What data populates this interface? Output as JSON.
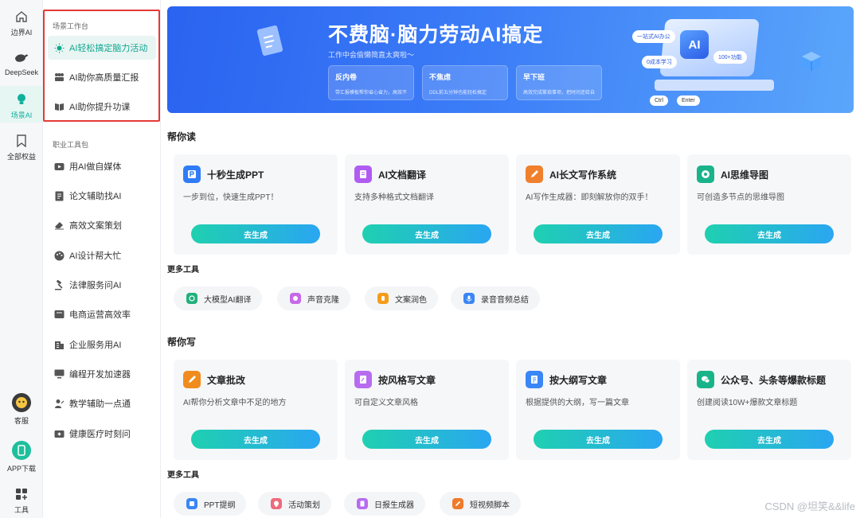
{
  "rail": {
    "items": [
      {
        "label": "边界AI",
        "icon": "home-icon"
      },
      {
        "label": "DeepSeek",
        "icon": "whale-icon"
      },
      {
        "label": "场景AI",
        "icon": "bulb-icon",
        "active": true
      },
      {
        "label": "全部权益",
        "icon": "bookmark-icon"
      },
      {
        "label": "客服",
        "icon": "service-avatar-icon"
      },
      {
        "label": "APP下载",
        "icon": "phone-icon"
      },
      {
        "label": "工具",
        "icon": "grid-icon"
      }
    ]
  },
  "panel": {
    "section1": "场景工作台",
    "workbench": [
      {
        "label": "AI轻松搞定脑力活动",
        "active": true
      },
      {
        "label": "AI助你高质量汇报"
      },
      {
        "label": "AI助你提升功课"
      }
    ],
    "section2": "职业工具包",
    "tools": [
      {
        "label": "用AI做自媒体"
      },
      {
        "label": "论文辅助找AI"
      },
      {
        "label": "高效文案策划"
      },
      {
        "label": "AI设计帮大忙"
      },
      {
        "label": "法律服务问AI"
      },
      {
        "label": "电商运营高效率"
      },
      {
        "label": "企业服务用AI"
      },
      {
        "label": "编程开发加速器"
      },
      {
        "label": "教学辅助一点通"
      },
      {
        "label": "健康医疗时刻问"
      }
    ]
  },
  "banner": {
    "title": "不费脑·脑力劳动AI搞定",
    "subtitle": "工作中会偷懒简直太爽啦～",
    "cards": [
      {
        "title": "反内卷",
        "desc": "带汇报模板帮你省心省力，高效不内卷"
      },
      {
        "title": "不焦虑",
        "desc": "DDL前五分钟也能轻松搞定"
      },
      {
        "title": "早下班",
        "desc": "高效完成繁琐事项，把时间还给自己"
      }
    ],
    "pills": [
      "一站式AI办公",
      "0成本学习",
      "100+功能"
    ],
    "art_text": "AI",
    "keys": [
      "Ctrl",
      "Enter"
    ]
  },
  "read": {
    "heading": "帮你读",
    "cards": [
      {
        "title": "十秒生成PPT",
        "desc": "一步到位，快速生成PPT！",
        "button": "去生成",
        "color": "#2f7cf6"
      },
      {
        "title": "AI文档翻译",
        "desc": "支持多种格式文档翻译",
        "button": "去生成",
        "color": "#b05cf2"
      },
      {
        "title": "AI长文写作系统",
        "desc": "AI写作生成器：即刻解放你的双手！",
        "button": "去生成",
        "color": "#f0802c"
      },
      {
        "title": "AI思维导图",
        "desc": "可创造多节点的思维导图",
        "button": "去生成",
        "color": "#19b38a"
      }
    ]
  },
  "more1": {
    "heading": "更多工具",
    "chips": [
      {
        "label": "大模型AI翻译",
        "color": "#22b07d"
      },
      {
        "label": "声音克隆",
        "color": "#c66ae8"
      },
      {
        "label": "文案润色",
        "color": "#f59c1a"
      },
      {
        "label": "录音音频总结",
        "color": "#3a86f6"
      }
    ]
  },
  "write": {
    "heading": "帮你写",
    "cards": [
      {
        "title": "文章批改",
        "desc": "AI帮你分析文章中不足的地方",
        "button": "去生成",
        "color": "#f08c1e"
      },
      {
        "title": "按风格写文章",
        "desc": "可自定义文章风格",
        "button": "去生成",
        "color": "#b76cf0"
      },
      {
        "title": "按大纲写文章",
        "desc": "根据提供的大纲，写一篇文章",
        "button": "去生成",
        "color": "#3a86f6"
      },
      {
        "title": "公众号、头条等爆款标题",
        "desc": "创建阅读10W+爆款文章标题",
        "button": "去生成",
        "color": "#19b38a"
      }
    ]
  },
  "more2": {
    "heading": "更多工具",
    "chips": [
      {
        "label": "PPT提纲",
        "color": "#3a86f6"
      },
      {
        "label": "活动策划",
        "color": "#ee6a7a"
      },
      {
        "label": "日报生成器",
        "color": "#b76cf0"
      },
      {
        "label": "短视频脚本",
        "color": "#f07a2a"
      }
    ]
  },
  "watermark": "CSDN @坦笑&&life"
}
